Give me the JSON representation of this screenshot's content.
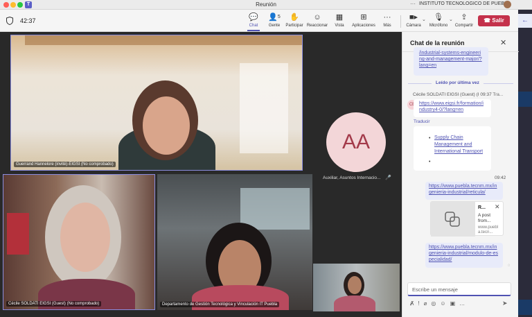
{
  "window": {
    "title": "Reunión",
    "org": "INSTITUTO TECNOLOGICO DE PUEBLA",
    "more": "···"
  },
  "toolbar": {
    "timer": "42:37",
    "buttons": [
      {
        "label": "Chat",
        "icon": "chat-icon",
        "glyph": "💬"
      },
      {
        "label": "Gente",
        "icon": "people-icon",
        "glyph": "👤",
        "count": "5"
      },
      {
        "label": "Participar",
        "icon": "raise-hand-icon",
        "glyph": "✋"
      },
      {
        "label": "Reaccionar",
        "icon": "smile-icon",
        "glyph": "☺"
      },
      {
        "label": "Vista",
        "icon": "grid-icon",
        "glyph": "▦"
      },
      {
        "label": "Aplicaciones",
        "icon": "plus-square-icon",
        "glyph": "⊞"
      },
      {
        "label": "Más",
        "icon": "more-icon",
        "glyph": "···"
      },
      {
        "label": "Cámara",
        "icon": "camera-icon",
        "glyph": "▶"
      },
      {
        "label": "Micrófono",
        "icon": "microphone-icon",
        "glyph": "🎙"
      },
      {
        "label": "Compartir",
        "icon": "share-icon",
        "glyph": "⇪"
      }
    ],
    "leave_label": "Salir",
    "leave_color": "#c4314b"
  },
  "stage": {
    "participants": [
      {
        "name": "Guerrand Hannelore (invité)-EIGSI (No comprobado)"
      },
      {
        "name": "Cécile SOLDATI EIGSI (Guest) (No comprobado)"
      },
      {
        "name": "Departamento de Gestión Tecnológica y Vinculación IT Puebla"
      },
      {
        "name": ""
      }
    ],
    "audio_only": {
      "initials": "AA",
      "name": "Auxiliar, Asuntos Internacio...",
      "muted": true
    }
  },
  "chat": {
    "title": "Chat de la reunión",
    "top_link": "/industrial-systems-engineering-and-management-major/?lang=en",
    "read_marker": "Leído por última vez",
    "sender": "Cécile SOLDATI EIGSI (Guest) (I",
    "sender_time": "09:37",
    "sender_translate_short": "Tra...",
    "sender_initials": "CE",
    "incoming_link": "https://www.eigsi.fr/formation/industry4-0/?lang=en",
    "translate_label": "Traducir",
    "bullet_link": "Supply Chain Management and International Transport",
    "out_time": "09:42",
    "out_link1": "https://www.puebla.tecnm.mx/ingenieria-industrial/reticula/",
    "preview": {
      "title": "R...",
      "desc": "A post from...",
      "domain": "www.puebla.tecn..."
    },
    "out_link2": "https://www.puebla.tecnm.mx/ingenieria-industrial/modulo-de-especialidad/",
    "compose_placeholder": "Escribe un mensaje",
    "accent": "#4f52b2"
  }
}
